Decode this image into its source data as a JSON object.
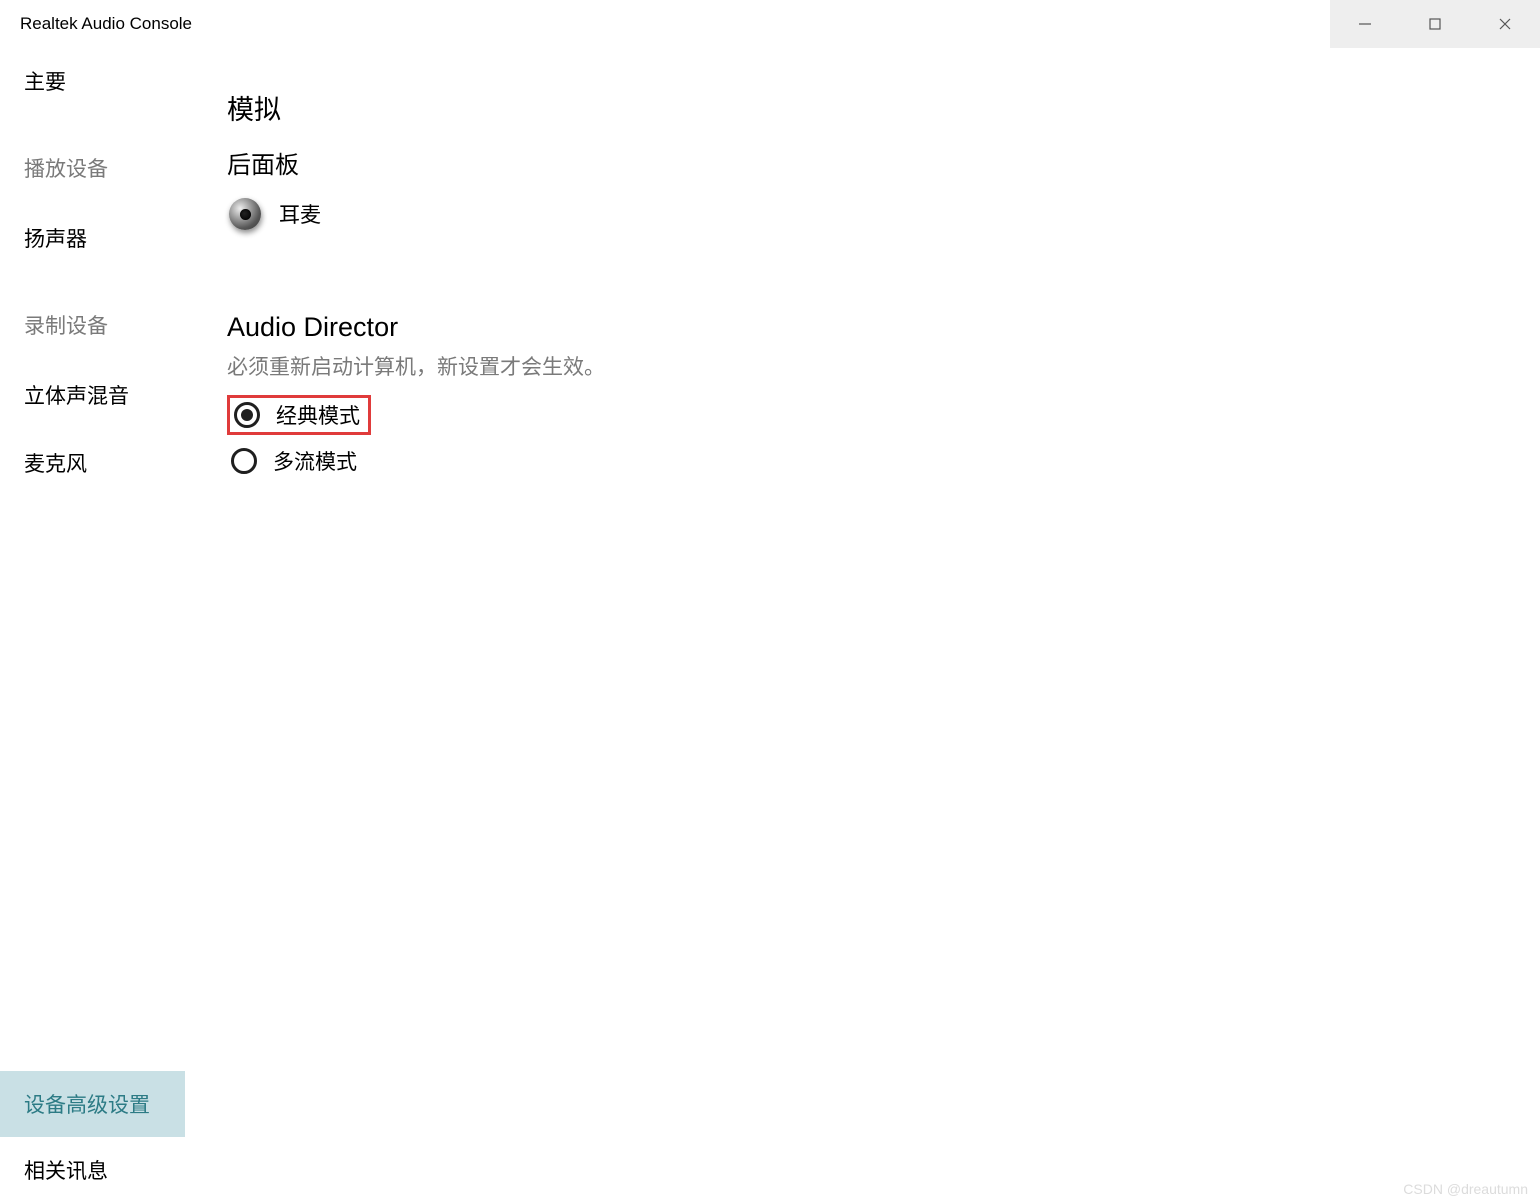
{
  "window": {
    "title": "Realtek Audio Console"
  },
  "sidebar": {
    "main": "主要",
    "playback_label": "播放设备",
    "playback_items": [
      "扬声器"
    ],
    "recording_label": "录制设备",
    "recording_items": [
      "立体声混音",
      "麦克风"
    ],
    "advanced": "设备高级设置",
    "related": "相关讯息"
  },
  "content": {
    "analog_heading": "模拟",
    "panel_heading": "后面板",
    "device_label": "耳麦",
    "audio_director": {
      "heading": "Audio Director",
      "note": "必须重新启动计算机，新设置才会生效。",
      "options": [
        {
          "label": "经典模式",
          "selected": true,
          "highlight": true
        },
        {
          "label": "多流模式",
          "selected": false,
          "highlight": false
        }
      ]
    }
  },
  "watermark": "CSDN @dreautumn"
}
